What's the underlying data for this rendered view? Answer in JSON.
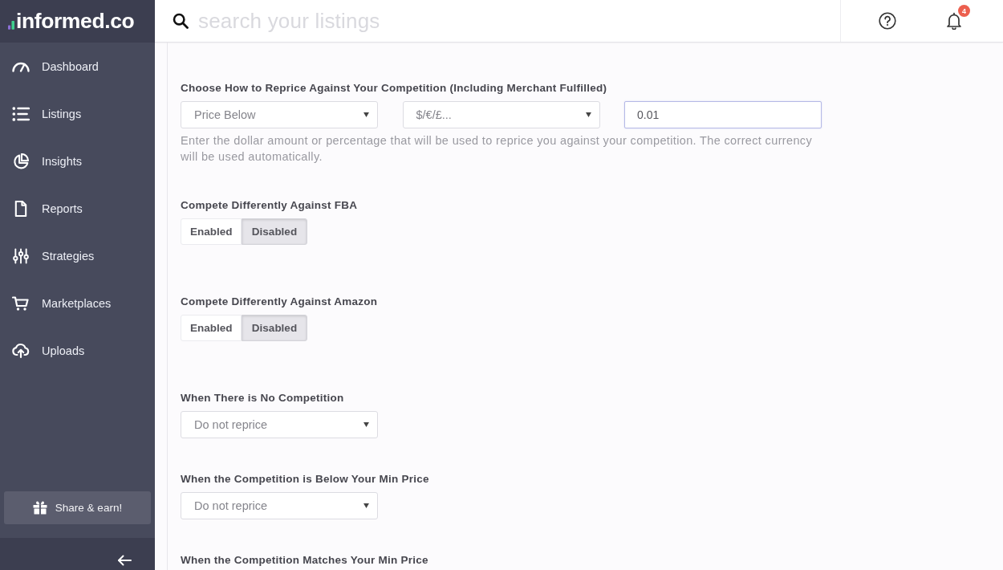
{
  "sidebar": {
    "logo": "informed.co",
    "nav_items": [
      {
        "label": "Dashboard"
      },
      {
        "label": "Listings"
      },
      {
        "label": "Insights"
      },
      {
        "label": "Reports"
      },
      {
        "label": "Strategies"
      },
      {
        "label": "Marketplaces"
      },
      {
        "label": "Uploads"
      }
    ],
    "share_button": "Share & earn!"
  },
  "topbar": {
    "search": {
      "placeholder": "search your listings"
    },
    "notifications": {
      "count": "4"
    }
  },
  "form": {
    "sections": [
      {
        "label": "Choose How to Reprice Against Your Competition (Including Merchant Fulfilled)",
        "controls": [
          {
            "kind": "select",
            "value": "Price Below"
          },
          {
            "kind": "select",
            "value": "$/€/£..."
          },
          {
            "kind": "input",
            "value": "0.01",
            "focused": true
          }
        ],
        "help": "Enter the dollar amount or percentage that will be used to reprice you against your competition. The correct currency will be used automatically."
      },
      {
        "label": "Compete Differently Against FBA",
        "controls": [
          {
            "kind": "toggle",
            "options": [
              {
                "label": "Enabled",
                "selected": false
              },
              {
                "label": "Disabled",
                "selected": true
              }
            ]
          }
        ]
      },
      {
        "label": "Compete Differently Against Amazon",
        "controls": [
          {
            "kind": "toggle",
            "options": [
              {
                "label": "Enabled",
                "selected": false
              },
              {
                "label": "Disabled",
                "selected": true
              }
            ]
          }
        ]
      },
      {
        "label": "When There is No Competition",
        "controls": [
          {
            "kind": "select",
            "value": "Do not reprice"
          }
        ]
      },
      {
        "label": "When the Competition is Below Your Min Price",
        "controls": [
          {
            "kind": "select",
            "value": "Do not reprice"
          }
        ]
      },
      {
        "label": "When the Competition Matches Your Min Price"
      }
    ]
  }
}
